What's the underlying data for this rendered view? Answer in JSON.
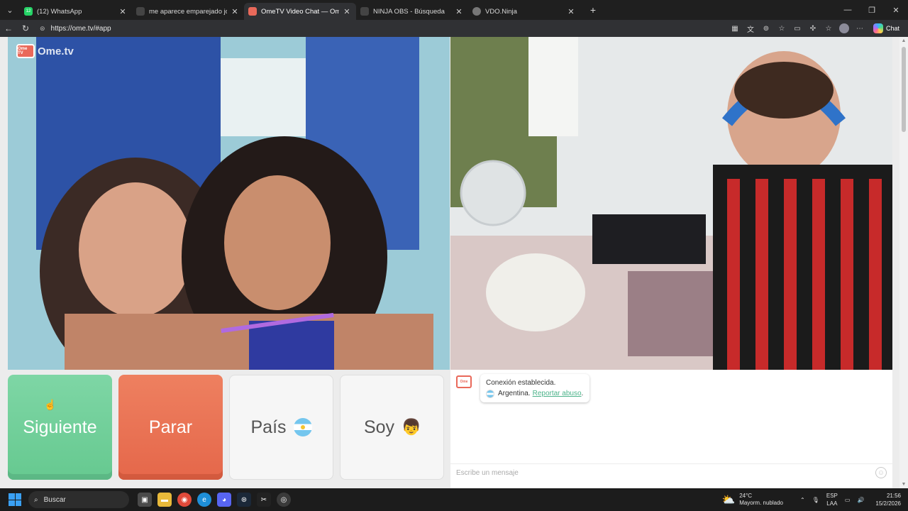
{
  "browser": {
    "tabs": [
      {
        "title": "(12) WhatsApp",
        "color": "#25d366",
        "badge": "12"
      },
      {
        "title": "me aparece emparejado joystick b",
        "color": "#303134",
        "badge": ""
      },
      {
        "title": "OmeTV Video Chat — Omegl",
        "color": "#e9695a",
        "badge": ""
      },
      {
        "title": "NINJA OBS - Búsqueda",
        "color": "#303134",
        "badge": ""
      },
      {
        "title": "VDO.Ninja",
        "color": "#303134",
        "badge": ""
      }
    ],
    "new_tab": "+",
    "url": "https://ome.tv/#app",
    "chat_label": "Chat"
  },
  "app": {
    "logo_text": "Ome.tv",
    "logo_badge": "Ome TV",
    "buttons": {
      "next": "Siguiente",
      "stop": "Parar",
      "country": "País",
      "gender": "Soy"
    },
    "chat": {
      "status": "Conexión establecida.",
      "country": "Argentina.",
      "report": "Reportar abuso",
      "report_suffix": ".",
      "placeholder": "Escribe un mensaje"
    }
  },
  "taskbar": {
    "search": "Buscar",
    "weather_temp": "24°C",
    "weather_desc": "Mayorm. nublado",
    "lang_1": "ESP",
    "lang_2": "LAA",
    "time": "21:56",
    "date": "15/2/2026"
  },
  "colors": {
    "next": "#6ccf97",
    "stop": "#e8704f",
    "accent": "#4cb38a"
  }
}
